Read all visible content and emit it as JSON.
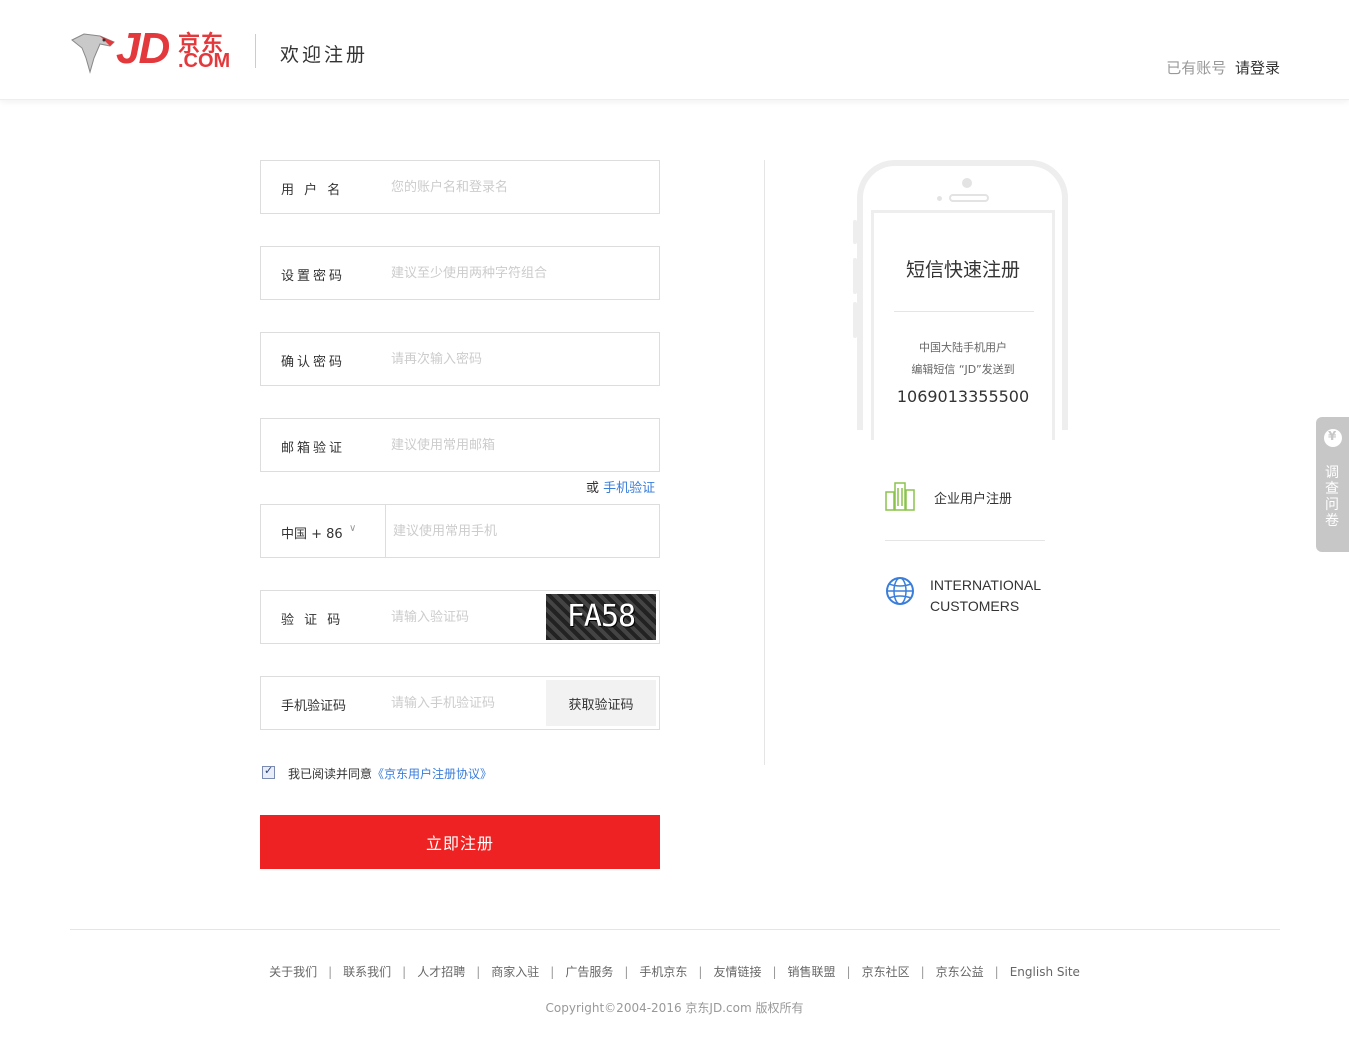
{
  "header": {
    "logo": {
      "brand": "JD",
      "brand_cn": "京东",
      "domain": ".COM"
    },
    "title": "欢迎注册",
    "login_prompt": "已有账号",
    "login_link": "请登录"
  },
  "form": {
    "username": {
      "label": "用 户 名",
      "placeholder": "您的账户名和登录名"
    },
    "password": {
      "label": "设置密码",
      "placeholder": "建议至少使用两种字符组合"
    },
    "confirm_password": {
      "label": "确认密码",
      "placeholder": "请再次输入密码"
    },
    "email": {
      "label": "邮箱验证",
      "placeholder": "建议使用常用邮箱"
    },
    "alt_verify": {
      "prefix": "或",
      "link": "手机验证"
    },
    "phone": {
      "country": "中国 + 86",
      "placeholder": "建议使用常用手机"
    },
    "captcha": {
      "label": "验 证 码",
      "placeholder": "请输入验证码",
      "image_text": "FA58"
    },
    "sms_code": {
      "label": "手机验证码",
      "placeholder": "请输入手机验证码",
      "button": "获取验证码"
    },
    "agreement": {
      "checked": true,
      "text": "我已阅读并同意",
      "link": "《京东用户注册协议》"
    },
    "submit": "立即注册"
  },
  "promo": {
    "title": "短信快速注册",
    "desc_line1": "中国大陆手机用户",
    "desc_line2": "编辑短信 “JD”发送到",
    "number": "1069013355500"
  },
  "side_links": {
    "enterprise": "企业用户注册",
    "international_line1": "INTERNATIONAL",
    "international_line2": "CUSTOMERS"
  },
  "survey": {
    "label": "调查问卷"
  },
  "footer": {
    "links": [
      "关于我们",
      "联系我们",
      "人才招聘",
      "商家入驻",
      "广告服务",
      "手机京东",
      "友情链接",
      "销售联盟",
      "京东社区",
      "京东公益",
      "English Site"
    ],
    "copyright": "Copyright©2004-2016  京东JD.com 版权所有"
  },
  "colors": {
    "accent_red": "#ee2222",
    "link_blue": "#3a7edb",
    "enterprise_green": "#8bc34a",
    "intl_blue": "#3a7edb"
  }
}
